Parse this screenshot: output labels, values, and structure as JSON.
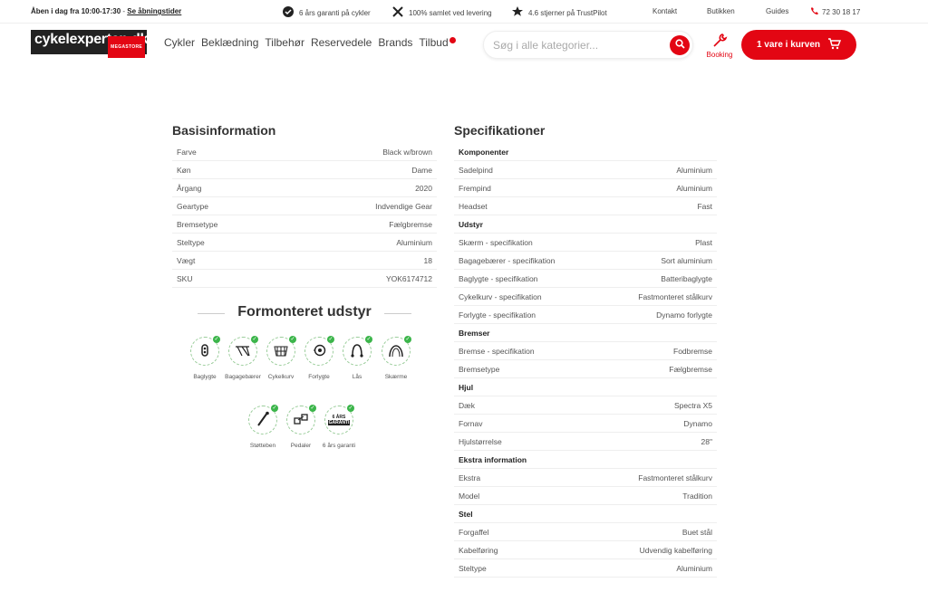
{
  "topbar": {
    "opening_text": "Åben i dag fra 10:00-17:30",
    "opening_sep": " - ",
    "opening_link": "Se åbningstider",
    "usps": [
      {
        "icon": "shield-check-icon",
        "text": "6 års garanti på cykler"
      },
      {
        "icon": "tools-icon",
        "text": "100% samlet ved levering"
      },
      {
        "icon": "star-icon",
        "text": "4.6 stjerner på TrustPilot"
      }
    ],
    "links": [
      "Kontakt",
      "Butikken",
      "Guides"
    ],
    "phone": "72 30 18 17"
  },
  "header": {
    "logo_text": "cykelexperten.dk",
    "logo_sub": "MEGASTORE",
    "nav": [
      "Cykler",
      "Beklædning",
      "Tilbehør",
      "Reservedele",
      "Brands",
      "Tilbud"
    ],
    "search_placeholder": "Søg i alle kategorier...",
    "booking": "Booking",
    "cart": "1 vare i kurven"
  },
  "basis": {
    "title": "Basisinformation",
    "rows": [
      {
        "label": "Farve",
        "value": "Black w/brown"
      },
      {
        "label": "Køn",
        "value": "Dame"
      },
      {
        "label": "Årgang",
        "value": "2020"
      },
      {
        "label": "Geartype",
        "value": "Indvendige Gear"
      },
      {
        "label": "Bremsetype",
        "value": "Fælgbremse"
      },
      {
        "label": "Steltype",
        "value": "Aluminium"
      },
      {
        "label": "Vægt",
        "value": "18"
      },
      {
        "label": "SKU",
        "value": "YOK6174712"
      }
    ]
  },
  "equipment": {
    "title": "Formonteret udstyr",
    "items": [
      {
        "label": "Baglygte",
        "icon": "rear-light-icon"
      },
      {
        "label": "Bagagebærer",
        "icon": "rack-icon"
      },
      {
        "label": "Cykelkurv",
        "icon": "basket-icon"
      },
      {
        "label": "Forlygte",
        "icon": "front-light-icon"
      },
      {
        "label": "Lås",
        "icon": "lock-icon"
      },
      {
        "label": "Skærme",
        "icon": "fender-icon"
      },
      {
        "label": "Støtteben",
        "icon": "kickstand-icon"
      },
      {
        "label": "Pedaler",
        "icon": "pedals-icon"
      },
      {
        "label": "6 års garanti",
        "icon": "guarantee-icon",
        "badge_top": "6 ÅRS",
        "badge_bottom": "GARANTI"
      }
    ]
  },
  "specs": {
    "title": "Specifikationer",
    "groups": [
      {
        "name": "Komponenter",
        "rows": [
          {
            "label": "Sadelpind",
            "value": "Aluminium"
          },
          {
            "label": "Frempind",
            "value": "Aluminium"
          },
          {
            "label": "Headset",
            "value": "Fast"
          }
        ]
      },
      {
        "name": "Udstyr",
        "rows": [
          {
            "label": "Skærm - specifikation",
            "value": "Plast"
          },
          {
            "label": "Bagagebærer - specifikation",
            "value": "Sort aluminium"
          },
          {
            "label": "Baglygte - specifikation",
            "value": "Batteribaglygte"
          },
          {
            "label": "Cykelkurv - specifikation",
            "value": "Fastmonteret stålkurv"
          },
          {
            "label": "Forlygte - specifikation",
            "value": "Dynamo forlygte"
          }
        ]
      },
      {
        "name": "Bremser",
        "rows": [
          {
            "label": "Bremse - specifikation",
            "value": "Fodbremse"
          },
          {
            "label": "Bremsetype",
            "value": "Fælgbremse"
          }
        ]
      },
      {
        "name": "Hjul",
        "rows": [
          {
            "label": "Dæk",
            "value": "Spectra X5"
          },
          {
            "label": "Fornav",
            "value": "Dynamo"
          },
          {
            "label": "Hjulstørrelse",
            "value": "28\""
          }
        ]
      },
      {
        "name": "Ekstra information",
        "rows": [
          {
            "label": "Ekstra",
            "value": "Fastmonteret stålkurv"
          },
          {
            "label": "Model",
            "value": "Tradition"
          }
        ]
      },
      {
        "name": "Stel",
        "rows": [
          {
            "label": "Forgaffel",
            "value": "Buet stål"
          },
          {
            "label": "Kabelføring",
            "value": "Udvendig kabelføring"
          },
          {
            "label": "Steltype",
            "value": "Aluminium"
          }
        ]
      }
    ]
  },
  "colors": {
    "brand_red": "#e30613",
    "check_green": "#3bb54a"
  }
}
